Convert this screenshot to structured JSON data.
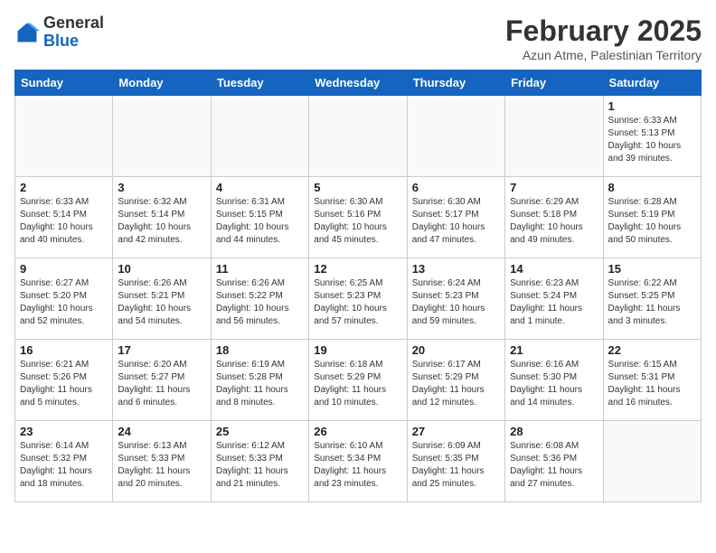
{
  "header": {
    "logo_general": "General",
    "logo_blue": "Blue",
    "title": "February 2025",
    "subtitle": "Azun Atme, Palestinian Territory"
  },
  "days_of_week": [
    "Sunday",
    "Monday",
    "Tuesday",
    "Wednesday",
    "Thursday",
    "Friday",
    "Saturday"
  ],
  "weeks": [
    [
      {
        "day": "",
        "info": ""
      },
      {
        "day": "",
        "info": ""
      },
      {
        "day": "",
        "info": ""
      },
      {
        "day": "",
        "info": ""
      },
      {
        "day": "",
        "info": ""
      },
      {
        "day": "",
        "info": ""
      },
      {
        "day": "1",
        "info": "Sunrise: 6:33 AM\nSunset: 5:13 PM\nDaylight: 10 hours\nand 39 minutes."
      }
    ],
    [
      {
        "day": "2",
        "info": "Sunrise: 6:33 AM\nSunset: 5:14 PM\nDaylight: 10 hours\nand 40 minutes."
      },
      {
        "day": "3",
        "info": "Sunrise: 6:32 AM\nSunset: 5:14 PM\nDaylight: 10 hours\nand 42 minutes."
      },
      {
        "day": "4",
        "info": "Sunrise: 6:31 AM\nSunset: 5:15 PM\nDaylight: 10 hours\nand 44 minutes."
      },
      {
        "day": "5",
        "info": "Sunrise: 6:30 AM\nSunset: 5:16 PM\nDaylight: 10 hours\nand 45 minutes."
      },
      {
        "day": "6",
        "info": "Sunrise: 6:30 AM\nSunset: 5:17 PM\nDaylight: 10 hours\nand 47 minutes."
      },
      {
        "day": "7",
        "info": "Sunrise: 6:29 AM\nSunset: 5:18 PM\nDaylight: 10 hours\nand 49 minutes."
      },
      {
        "day": "8",
        "info": "Sunrise: 6:28 AM\nSunset: 5:19 PM\nDaylight: 10 hours\nand 50 minutes."
      }
    ],
    [
      {
        "day": "9",
        "info": "Sunrise: 6:27 AM\nSunset: 5:20 PM\nDaylight: 10 hours\nand 52 minutes."
      },
      {
        "day": "10",
        "info": "Sunrise: 6:26 AM\nSunset: 5:21 PM\nDaylight: 10 hours\nand 54 minutes."
      },
      {
        "day": "11",
        "info": "Sunrise: 6:26 AM\nSunset: 5:22 PM\nDaylight: 10 hours\nand 56 minutes."
      },
      {
        "day": "12",
        "info": "Sunrise: 6:25 AM\nSunset: 5:23 PM\nDaylight: 10 hours\nand 57 minutes."
      },
      {
        "day": "13",
        "info": "Sunrise: 6:24 AM\nSunset: 5:23 PM\nDaylight: 10 hours\nand 59 minutes."
      },
      {
        "day": "14",
        "info": "Sunrise: 6:23 AM\nSunset: 5:24 PM\nDaylight: 11 hours\nand 1 minute."
      },
      {
        "day": "15",
        "info": "Sunrise: 6:22 AM\nSunset: 5:25 PM\nDaylight: 11 hours\nand 3 minutes."
      }
    ],
    [
      {
        "day": "16",
        "info": "Sunrise: 6:21 AM\nSunset: 5:26 PM\nDaylight: 11 hours\nand 5 minutes."
      },
      {
        "day": "17",
        "info": "Sunrise: 6:20 AM\nSunset: 5:27 PM\nDaylight: 11 hours\nand 6 minutes."
      },
      {
        "day": "18",
        "info": "Sunrise: 6:19 AM\nSunset: 5:28 PM\nDaylight: 11 hours\nand 8 minutes."
      },
      {
        "day": "19",
        "info": "Sunrise: 6:18 AM\nSunset: 5:29 PM\nDaylight: 11 hours\nand 10 minutes."
      },
      {
        "day": "20",
        "info": "Sunrise: 6:17 AM\nSunset: 5:29 PM\nDaylight: 11 hours\nand 12 minutes."
      },
      {
        "day": "21",
        "info": "Sunrise: 6:16 AM\nSunset: 5:30 PM\nDaylight: 11 hours\nand 14 minutes."
      },
      {
        "day": "22",
        "info": "Sunrise: 6:15 AM\nSunset: 5:31 PM\nDaylight: 11 hours\nand 16 minutes."
      }
    ],
    [
      {
        "day": "23",
        "info": "Sunrise: 6:14 AM\nSunset: 5:32 PM\nDaylight: 11 hours\nand 18 minutes."
      },
      {
        "day": "24",
        "info": "Sunrise: 6:13 AM\nSunset: 5:33 PM\nDaylight: 11 hours\nand 20 minutes."
      },
      {
        "day": "25",
        "info": "Sunrise: 6:12 AM\nSunset: 5:33 PM\nDaylight: 11 hours\nand 21 minutes."
      },
      {
        "day": "26",
        "info": "Sunrise: 6:10 AM\nSunset: 5:34 PM\nDaylight: 11 hours\nand 23 minutes."
      },
      {
        "day": "27",
        "info": "Sunrise: 6:09 AM\nSunset: 5:35 PM\nDaylight: 11 hours\nand 25 minutes."
      },
      {
        "day": "28",
        "info": "Sunrise: 6:08 AM\nSunset: 5:36 PM\nDaylight: 11 hours\nand 27 minutes."
      },
      {
        "day": "",
        "info": ""
      }
    ]
  ]
}
